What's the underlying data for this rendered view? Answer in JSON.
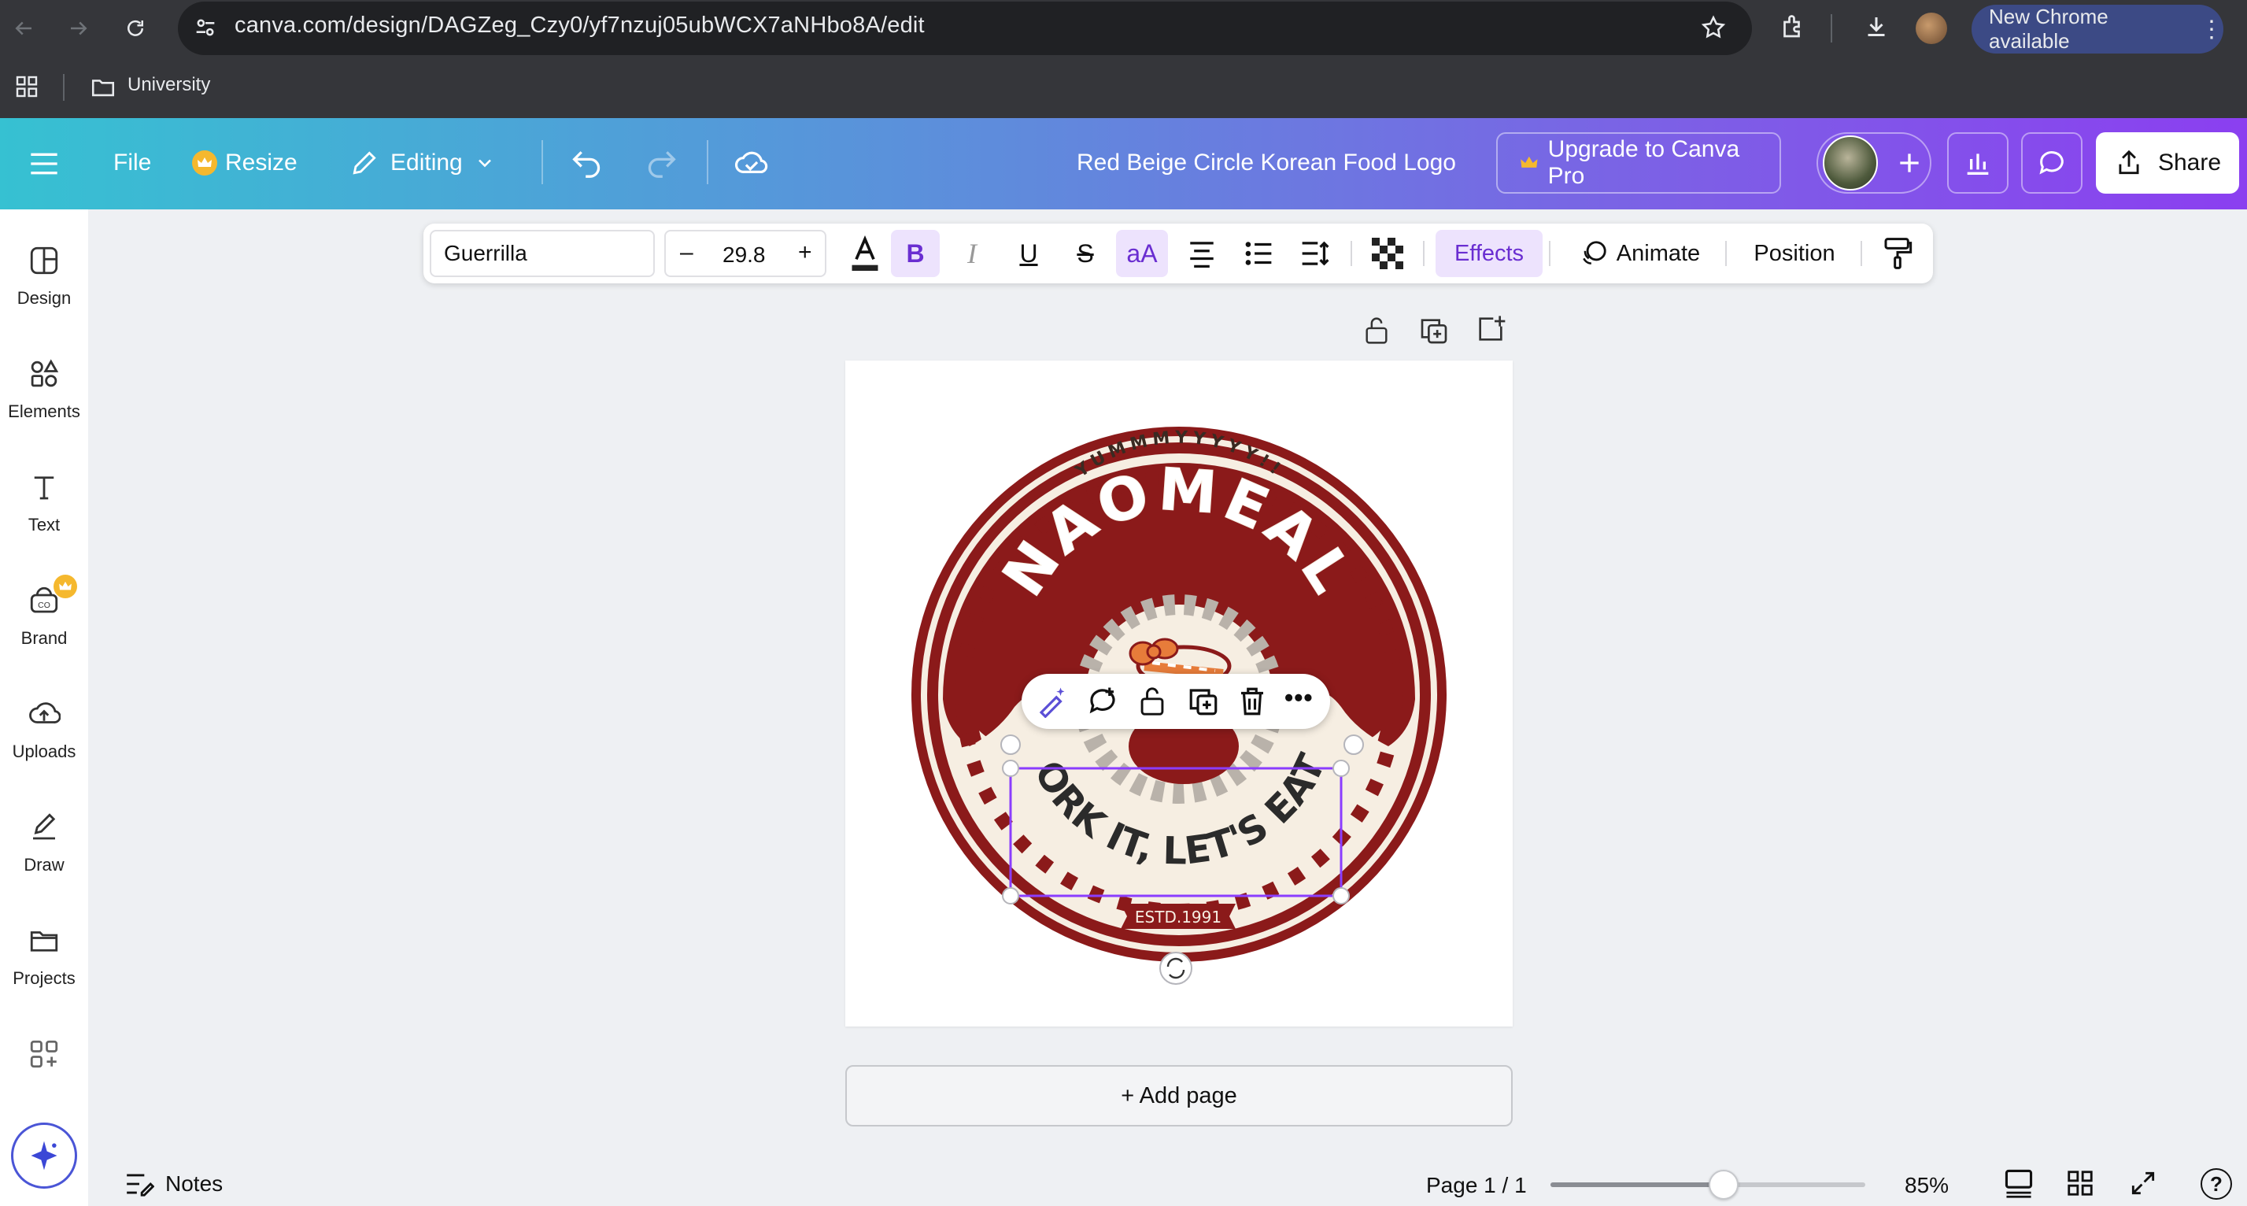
{
  "browser": {
    "url": "canva.com/design/DAGZeg_Czy0/yf7nzuj05ubWCX7aNHbo8A/edit",
    "new_chrome_label": "New Chrome available",
    "bookmark_folder": "University"
  },
  "header": {
    "file_label": "File",
    "resize_label": "Resize",
    "editing_label": "Editing",
    "design_title": "Red Beige Circle Korean Food Logo",
    "upgrade_label": "Upgrade to Canva Pro",
    "share_label": "Share"
  },
  "sidebar": {
    "items": [
      {
        "label": "Design",
        "icon": "layout-icon"
      },
      {
        "label": "Elements",
        "icon": "shapes-icon"
      },
      {
        "label": "Text",
        "icon": "text-icon"
      },
      {
        "label": "Brand",
        "icon": "brand-icon"
      },
      {
        "label": "Uploads",
        "icon": "cloud-upload-icon"
      },
      {
        "label": "Draw",
        "icon": "pen-icon"
      },
      {
        "label": "Projects",
        "icon": "folder-icon"
      }
    ]
  },
  "toolbar": {
    "font_name": "Guerrilla",
    "font_size": "29.8",
    "effects_label": "Effects",
    "animate_label": "Animate",
    "position_label": "Position"
  },
  "logo": {
    "top_text": "YUMMMYYYYY!!",
    "brand_text": "NAOMEAL",
    "tagline": "FORK IT, LET'S EAT!",
    "estd_text": "ESTD.1991"
  },
  "canvas": {
    "add_page_label": "+ Add page"
  },
  "footer": {
    "notes_label": "Notes",
    "page_indicator": "Page 1 / 1",
    "zoom_label": "85%",
    "zoom_fraction": 0.55
  },
  "colors": {
    "brand_red": "#8b1a1a",
    "cream": "#f6eee2",
    "canva_purple": "#7d2ae8",
    "selection": "#8b3dff"
  }
}
